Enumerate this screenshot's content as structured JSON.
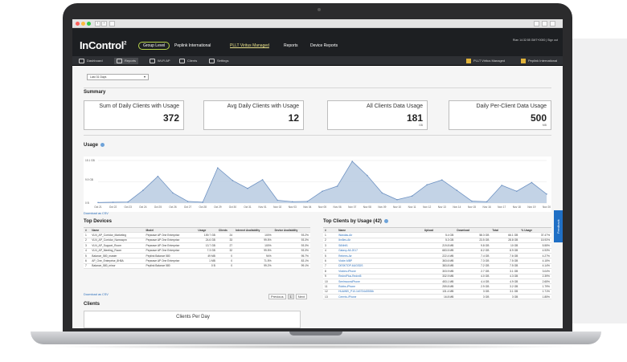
{
  "app": {
    "logo": "InControl",
    "logo_sup": "2"
  },
  "breadcrumbs": [
    "Group Level",
    "Peplink International",
    "PLLT Viritus Managed",
    "Reports",
    "Device Reports"
  ],
  "account_text": "Rian 14:32:55 GMT+0000 | Sign out",
  "subnav": {
    "left": [
      "Dashboard",
      "Reports",
      "Wi-Fi AP",
      "Clients",
      "Settings"
    ],
    "right": [
      "PLLT Viritus Managed",
      "Peplink International"
    ]
  },
  "range_select": {
    "value": "Last 31 Days"
  },
  "summary": {
    "title": "Summary",
    "cards": [
      {
        "label": "Sum of Daily Clients with Usage",
        "value": "372",
        "unit": ""
      },
      {
        "label": "Avg Daily Clients with Usage",
        "value": "12",
        "unit": ""
      },
      {
        "label": "All Clients Data Usage",
        "value": "181",
        "unit": "GB"
      },
      {
        "label": "Daily Per-Client Data Usage",
        "value": "500",
        "unit": "MB"
      }
    ]
  },
  "usage_title": "Usage",
  "download_csv": "Download as CSV",
  "feedback": "Feedback",
  "chart_data": {
    "type": "area",
    "title": "",
    "y_tick_labels": [
      "15.1 GB",
      "9.9 GB",
      "0 B"
    ],
    "ylim": [
      0,
      15.1
    ],
    "x": [
      "Oct 21",
      "Oct 22",
      "Oct 23",
      "Oct 24",
      "Oct 25",
      "Oct 26",
      "Oct 27",
      "Oct 28",
      "Oct 29",
      "Oct 30",
      "Oct 31",
      "Nov 01",
      "Nov 02",
      "Nov 03",
      "Nov 04",
      "Nov 05",
      "Nov 06",
      "Nov 07",
      "Nov 08",
      "Nov 09",
      "Nov 10",
      "Nov 11",
      "Nov 12",
      "Nov 13",
      "Nov 14",
      "Nov 15",
      "Nov 16",
      "Nov 17",
      "Nov 18",
      "Nov 19",
      "Nov 20"
    ],
    "series": [
      {
        "values": [
          0.2,
          0.3,
          0.4,
          4.5,
          9.5,
          3.6,
          0.6,
          0.3,
          12.5,
          8.0,
          5.2,
          8.3,
          1.0,
          0.5,
          0.6,
          4.2,
          6.0,
          14.8,
          9.8,
          3.6,
          1.2,
          2.5,
          6.5,
          8.2,
          4.5,
          0.7,
          0.5,
          6.3,
          4.2,
          7.3,
          3.2
        ]
      }
    ],
    "fill_color": "#b8cbe2",
    "line_color": "#6f93c3",
    "grid": true
  },
  "top_devices": {
    "title": "Top Devices",
    "columns": [
      "#",
      "Name",
      "Model",
      "Usage",
      "Clients",
      "Internet Availability",
      "Device Availability"
    ],
    "rows": [
      [
        "1",
        "VLN_AP_Corridor_Marketing",
        "Pepwave AP One Enterprise",
        "159.7 GB",
        "24",
        "100%",
        "93.2%"
      ],
      [
        "2",
        "VLN_AP_Corridor_Narrowpm",
        "Pepwave AP One Enterprise",
        "24.6 GB",
        "33",
        "99.5%",
        "93.3%"
      ],
      [
        "3",
        "VLN_AP_Support_Room",
        "Pepwave AP One Enterprise",
        "13.7 GB",
        "27",
        "100%",
        "93.3%"
      ],
      [
        "4",
        "VLN_AP_Meeting_Room",
        "Pepwave AP One Enterprise",
        "7.3 GB",
        "32",
        "99.5%",
        "93.3%"
      ],
      [
        "5",
        "Balance_580_master",
        "Peplink Balance 580",
        "49 MB",
        "0",
        "94%",
        "95.7%"
      ],
      [
        "6",
        "AP_One_Enterprise_8H8A",
        "Pepwave AP One Enterprise",
        "1 MB",
        "0",
        "71.5%",
        "83.1%"
      ],
      [
        "7",
        "Balance_580_minor",
        "Peplink Balance 580",
        "0 B",
        "0",
        "99.2%",
        "99.1%"
      ]
    ],
    "pager": {
      "prev": "Previous",
      "page": "1",
      "next": "Next"
    }
  },
  "top_clients": {
    "title": "Top Clients by Usage (42)",
    "columns": [
      "#",
      "Name",
      "Upload",
      "Download",
      "Total",
      "% Usage"
    ],
    "rows": [
      [
        "1",
        "Wandas-Air",
        "5.4 GB",
        "58.3 GB",
        "66.1 GB",
        "37.47%"
      ],
      [
        "2",
        "Ibn5es-Air",
        "5.3 GB",
        "23.5 GB",
        "28.8 GB",
        "15.93%"
      ],
      [
        "3",
        "S6Nhlf1",
        "219.8 MB",
        "9.8 GB",
        "10 GB",
        "5.55%"
      ],
      [
        "4",
        "Galaxy-A5-2017",
        "683.5 MB",
        "8.2 GB",
        "8.9 GB",
        "4.93%"
      ],
      [
        "5",
        "Rebees-Air",
        "222.4 MB",
        "7.4 GB",
        "7.6 GB",
        "4.27%"
      ],
      [
        "6",
        "Vickie-MBP",
        "363.6 MB",
        "7.3 GB",
        "7.5 GB",
        "4.15%"
      ],
      [
        "7",
        "DESKTOP-6UGSDS",
        "383.8 MB",
        "7.2 GB",
        "7.5 GB",
        "4.14%"
      ],
      [
        "8",
        "Vickies-iPhone",
        "303.9 MB",
        "2.7 GB",
        "3.1 GB",
        "3.04%"
      ],
      [
        "9",
        "RedmiPlus-Redmi5",
        "332.9 MB",
        "4.0 GB",
        "4.3 GB",
        "2.39%"
      ],
      [
        "10",
        "SeelmoonsiPhone",
        "453.1 MB",
        "4.4 GB",
        "4.9 GB",
        "2.65%"
      ],
      [
        "11",
        "Robbs-iPhone",
        "259.8 MB",
        "2.9 GB",
        "3.2 GB",
        "1.79%"
      ],
      [
        "12",
        "HUAWEI_P10-1b3734d3926b",
        "131.4 MB",
        "3 GB",
        "3.1 GB",
        "1.71%"
      ],
      [
        "13",
        "Cerrnts-iPhone",
        "16.8 MB",
        "3 GB",
        "3 GB",
        "1.85%"
      ]
    ]
  },
  "clients_title": "Clients",
  "clients_per_day_title": "Clients Per Day",
  "colors": {
    "header_bg": "#1d1f22",
    "accent_green": "#b7d34a",
    "link_blue": "#2a6ebb",
    "feedback_blue": "#1f6fc5"
  }
}
